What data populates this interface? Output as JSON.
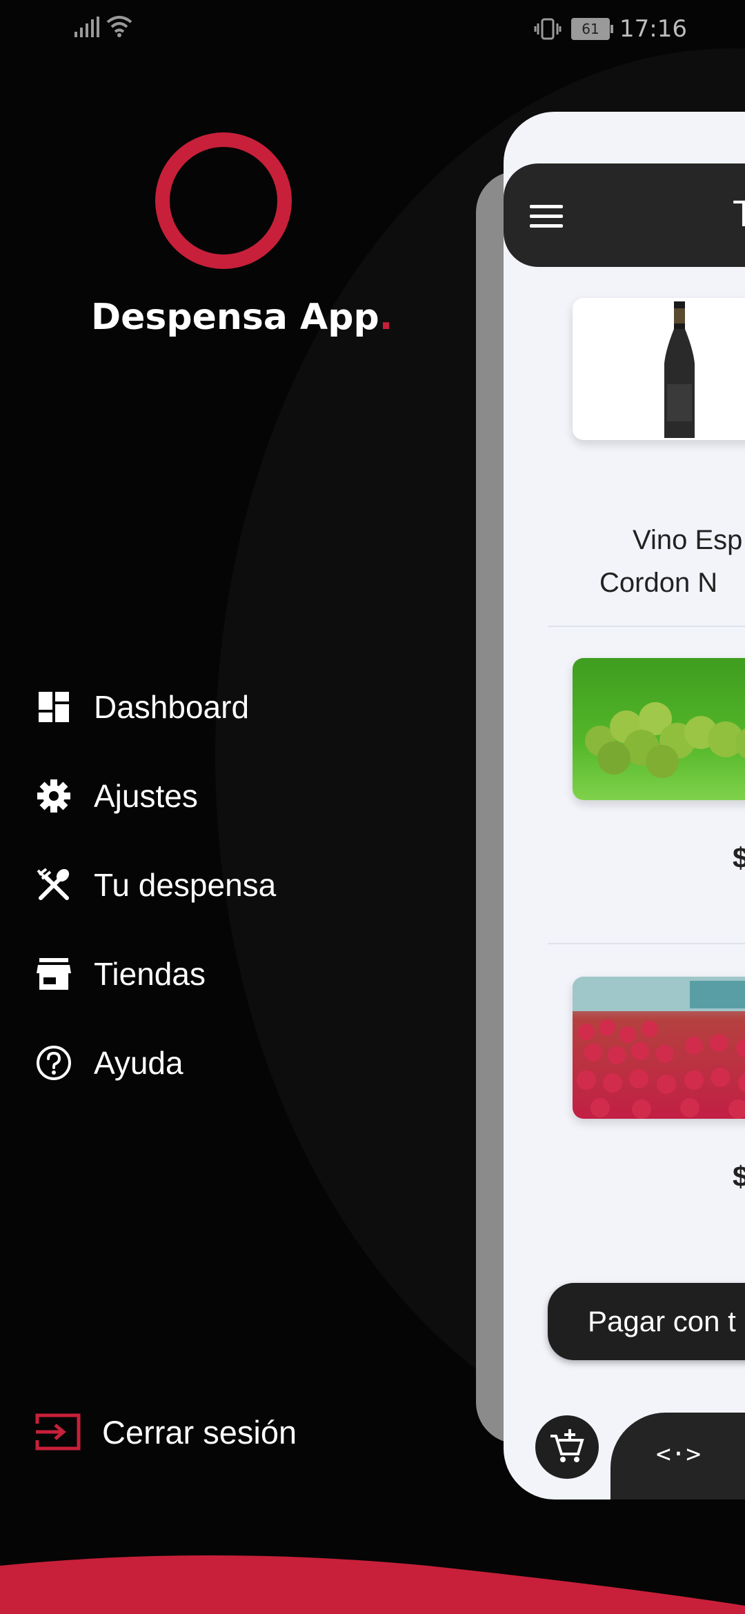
{
  "status_bar": {
    "time": "17:16",
    "battery": "61"
  },
  "app": {
    "title": "Despensa App",
    "title_dot": "."
  },
  "menu": {
    "items": [
      {
        "label": "Dashboard",
        "icon": "dashboard-icon"
      },
      {
        "label": "Ajustes",
        "icon": "gear-icon"
      },
      {
        "label": "Tu despensa",
        "icon": "utensils-icon"
      },
      {
        "label": "Tiendas",
        "icon": "store-icon"
      },
      {
        "label": "Ayuda",
        "icon": "help-icon"
      }
    ],
    "logout_label": "Cerrar sesión"
  },
  "preview": {
    "header_title": "T",
    "products": [
      {
        "name_line1": "Vino Esp",
        "name_line2": "Cordon N"
      },
      {
        "price": "$"
      },
      {
        "price": "$"
      }
    ],
    "pay_button_label": "Pagar con t",
    "nav_code_label": "<·>"
  },
  "colors": {
    "accent": "#c8203a",
    "background": "#050505",
    "panel": "#f2f4fa",
    "dark": "#262626"
  }
}
